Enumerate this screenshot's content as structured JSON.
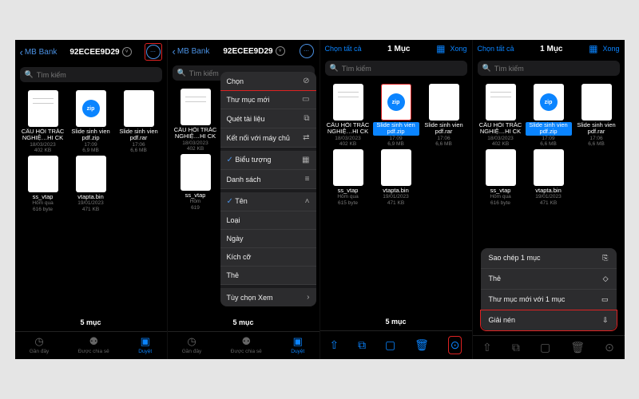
{
  "screens": [
    {
      "back": "MB Bank",
      "title": "92ECEE9D29",
      "search": "Tìm kiếm",
      "files": [
        {
          "name": "CÂU HỎI TRẮC NGHIỆ…HI CK",
          "date": "18/03/2023",
          "size": "402 KB",
          "kind": "doc"
        },
        {
          "name": "Slide sinh vien pdf.zip",
          "date": "17:09",
          "size": "6,9 MB",
          "kind": "zip"
        },
        {
          "name": "Slide sinh vien pdf.rar",
          "date": "17:06",
          "size": "6,6 MB",
          "kind": "blank"
        },
        {
          "name": "ss_vtap",
          "date": "Hôm qua",
          "size": "616 byte",
          "kind": "blank"
        },
        {
          "name": "vtapta.bin",
          "date": "19/01/2023",
          "size": "471 KB",
          "kind": "blank"
        }
      ],
      "count": "5 mục",
      "tabs": [
        "Gần đây",
        "Được chia sẻ",
        "Duyệt"
      ]
    },
    {
      "back": "MB Bank",
      "title": "92ECEE9D29",
      "search": "Tìm kiếm",
      "menu": [
        {
          "label": "Chọn",
          "icon": "⊘",
          "hl": true
        },
        {
          "label": "Thư mục mới",
          "icon": "▭"
        },
        {
          "label": "Quét tài liệu",
          "icon": "⧉"
        },
        {
          "label": "Kết nối với máy chủ",
          "icon": "⇄"
        },
        {
          "sep": true
        },
        {
          "label": "Biểu tượng",
          "icon": "▦",
          "check": true
        },
        {
          "label": "Danh sách",
          "icon": "≡"
        },
        {
          "sep": true
        },
        {
          "label": "Tên",
          "icon": "˄",
          "check": true
        },
        {
          "label": "Loại",
          "icon": ""
        },
        {
          "label": "Ngày",
          "icon": ""
        },
        {
          "label": "Kích cỡ",
          "icon": ""
        },
        {
          "label": "Thẻ",
          "icon": ""
        },
        {
          "sep": true
        },
        {
          "label": "Tùy chọn Xem",
          "icon": "›"
        }
      ],
      "files": [
        {
          "name": "CÂU HỎI TRẮC NGHIỆ…HI CK",
          "date": "18/03/2023",
          "size": "402 KB",
          "kind": "doc"
        },
        {
          "name": "",
          "date": "",
          "size": "",
          "kind": "none"
        },
        {
          "name": "",
          "date": "",
          "size": "",
          "kind": "none"
        },
        {
          "name": "ss_vtap",
          "date": "Hôm",
          "size": "619",
          "kind": "blank"
        }
      ],
      "count": "5 mục",
      "tabs": [
        "Gần đây",
        "Được chia sẻ",
        "Duyệt"
      ]
    },
    {
      "selectAll": "Chọn tất cả",
      "titleCount": "1 Mục",
      "done": "Xong",
      "search": "Tìm kiếm",
      "files": [
        {
          "name": "CÂU HỎI TRẮC NGHIỆ…HI CK",
          "date": "18/03/2023",
          "size": "402 KB",
          "kind": "doc"
        },
        {
          "name": "Slide sinh vien pdf.zip",
          "date": "17:09",
          "size": "6,9 MB",
          "kind": "zip",
          "sel": true
        },
        {
          "name": "Slide sinh vien pdf.rar",
          "date": "17:06",
          "size": "6,6 MB",
          "kind": "blank"
        },
        {
          "name": "ss_vtap",
          "date": "Hôm qua",
          "size": "615 byte",
          "kind": "blank"
        },
        {
          "name": "vtapta.bin",
          "date": "19/01/2023",
          "size": "471 KB",
          "kind": "blank"
        }
      ],
      "count": "5 mục",
      "toolbar": [
        "share",
        "dup",
        "move",
        "trash",
        "more"
      ]
    },
    {
      "selectAll": "Chọn tất cả",
      "titleCount": "1 Mục",
      "done": "Xong",
      "search": "Tìm kiếm",
      "files": [
        {
          "name": "CÂU HỎI TRẮC NGHIỆ…HI CK",
          "date": "18/03/2023",
          "size": "402 KB",
          "kind": "doc"
        },
        {
          "name": "Slide sinh vien pdf.zip",
          "date": "17:09",
          "size": "6,6 MB",
          "kind": "zip",
          "selBlue": true
        },
        {
          "name": "Slide sinh vien pdf.rar",
          "date": "17:06",
          "size": "6,6 MB",
          "kind": "blank"
        },
        {
          "name": "ss_vtap",
          "date": "Hôm qua",
          "size": "616 byte",
          "kind": "blank"
        },
        {
          "name": "vtapta.bin",
          "date": "19/01/2023",
          "size": "471 KB",
          "kind": "blank"
        }
      ],
      "ctx": [
        {
          "label": "Sao chép 1 mục",
          "icon": "⎘"
        },
        {
          "label": "Thẻ",
          "icon": "◇"
        },
        {
          "label": "Thư mục mới với 1 mục",
          "icon": "▭"
        },
        {
          "label": "Giải nén",
          "icon": "⇩",
          "hl": true
        }
      ],
      "toolbar": [
        "share",
        "dup",
        "move",
        "trash",
        "more"
      ]
    }
  ]
}
